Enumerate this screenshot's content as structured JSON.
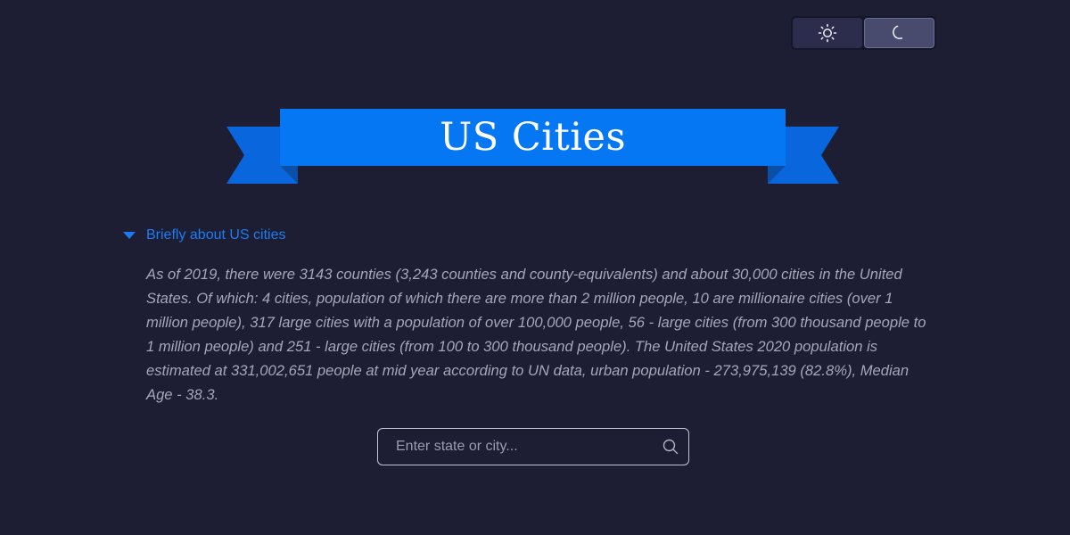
{
  "theme_toggle": {
    "options": [
      {
        "name": "light",
        "icon": "sun-icon"
      },
      {
        "name": "dark",
        "icon": "moon-icon"
      }
    ],
    "active": "dark"
  },
  "header": {
    "title": "US Cities"
  },
  "about": {
    "summary": "Briefly about US cities",
    "expanded": true,
    "text": "As of 2019, there were 3143 counties (3,243 counties and county-equivalents) and about 30,000 cities in the United States. Of which: 4 cities, population of which there are more than 2 million people, 10 are millionaire cities (over 1 million people), 317 large cities with a population of over 100,000 people, 56 - large cities (from 300 thousand people to 1 million people) and 251 - large cities (from 100 to 300 thousand people). The United States 2020 population is estimated at 331,002,651 people at mid year according to UN data, urban population - 273,975,139 (82.8%), Median Age - 38.3."
  },
  "search": {
    "placeholder": "Enter state or city...",
    "value": "",
    "icon": "search-icon"
  },
  "colors": {
    "background": "#1d1e33",
    "accent": "#1d7cf2",
    "ribbon": "#0677f3",
    "ribbon_dark": "#0a5fc9",
    "text_muted": "#a5a6b8"
  }
}
